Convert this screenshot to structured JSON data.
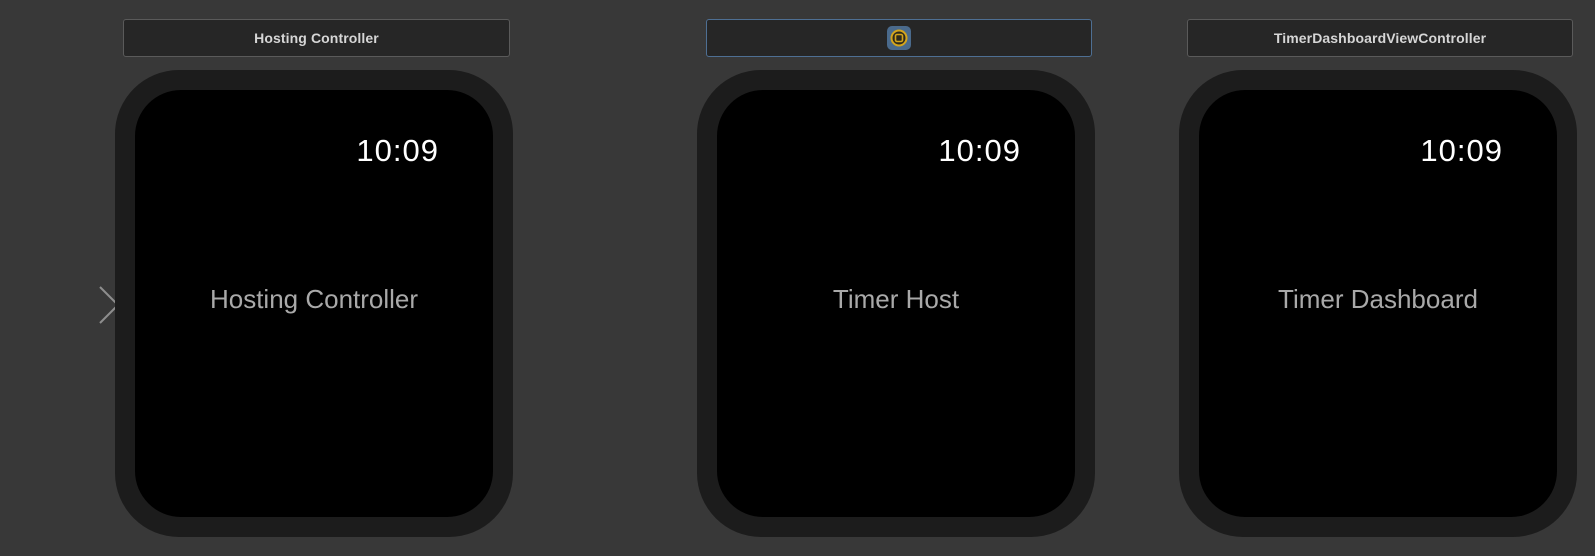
{
  "storyboard": {
    "scenes": [
      {
        "header_label": "Hosting Controller",
        "clock_time": "10:09",
        "screen_title": "Hosting Controller"
      },
      {
        "header_label": "",
        "header_icon": "interface-controller-icon",
        "clock_time": "10:09",
        "screen_title": "Timer Host"
      },
      {
        "header_label": "TimerDashboardViewController",
        "clock_time": "10:09",
        "screen_title": "Timer Dashboard"
      }
    ]
  },
  "colors": {
    "canvas": "#383838",
    "header_bg": "#262626",
    "watch_bezel": "#1c1c1c",
    "screen": "#000000",
    "selected_border": "#4e6f93",
    "icon_bg": "#4a6a8c",
    "icon_ring": "#d4a51c"
  }
}
